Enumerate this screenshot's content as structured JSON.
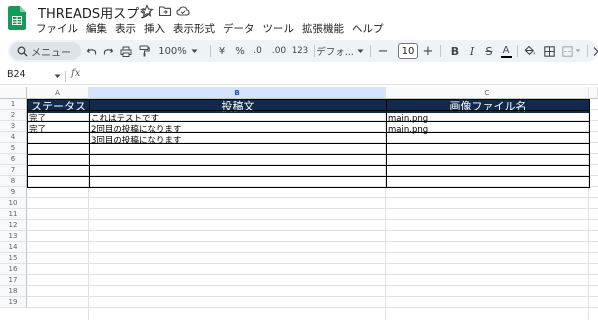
{
  "title_bar": {
    "doc_title": "THREADS用スプシ",
    "icons": [
      "star-icon",
      "move-to-folder-icon",
      "cloud-status-icon"
    ]
  },
  "menu": [
    "ファイル",
    "編集",
    "表示",
    "挿入",
    "表示形式",
    "データ",
    "ツール",
    "拡張機能",
    "ヘルプ"
  ],
  "toolbar": {
    "search_label": "メニュー",
    "zoom": "100%",
    "currency": "¥",
    "percent": "%",
    "decrease_decimal": ".0",
    "increase_decimal": ".00",
    "number_format": "123",
    "font": "デフォ...",
    "font_size": "10",
    "decrease_font_size": "−",
    "increase_font_size": "+",
    "bold": "B",
    "italic": "I",
    "strikethrough": "S",
    "text_color_letter": "A"
  },
  "formula_bar": {
    "name_box": "B24",
    "fx": "fx",
    "value": ""
  },
  "grid": {
    "columns": [
      "A",
      "B",
      "C"
    ],
    "selected_column": "B",
    "rows": [
      "1",
      "2",
      "3",
      "4",
      "5",
      "6",
      "7",
      "8",
      "9",
      "10",
      "11",
      "12",
      "13",
      "14",
      "15",
      "16",
      "17",
      "18",
      "19"
    ],
    "header_fill": "#0f2a4a",
    "header": [
      "ステータス",
      "投稿文",
      "画像ファイル名"
    ],
    "data": [
      [
        "完了",
        "これはテストです",
        "main.png"
      ],
      [
        "完了",
        "2回目の投稿になります",
        "main.png"
      ],
      [
        "",
        "3回目の投稿になります",
        ""
      ]
    ]
  },
  "colors": {
    "accent": "#0b57d0",
    "sheets_green": "#0f9d58",
    "toolbar_bg": "#eef2f9"
  }
}
